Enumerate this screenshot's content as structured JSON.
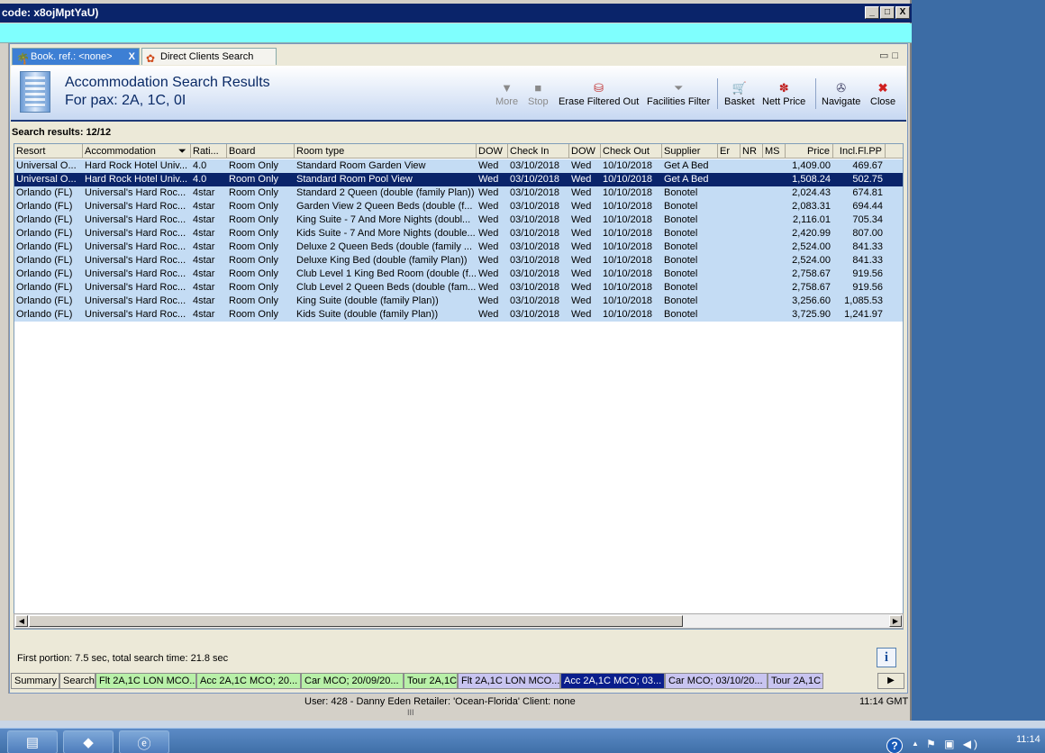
{
  "window": {
    "title": "code: x8ojMptYaU)",
    "minimize": "_",
    "maximize": "□",
    "close": "X"
  },
  "tabs": [
    {
      "label": "Book. ref.: <none>",
      "close": "X"
    },
    {
      "label": "Direct Clients Search"
    }
  ],
  "header": {
    "title": "Accommodation Search Results",
    "subtitle": "For pax: 2A, 1C, 0I"
  },
  "toolbar": {
    "more": "More",
    "stop": "Stop",
    "erase": "Erase Filtered Out",
    "facilities": "Facilities Filter",
    "basket": "Basket",
    "nett": "Nett Price",
    "navigate": "Navigate",
    "close": "Close"
  },
  "results": {
    "label": "Search results: 12/12",
    "columns": [
      "Resort",
      "Accommodation",
      "Rati...",
      "Board",
      "Room type",
      "DOW",
      "Check In",
      "DOW",
      "Check Out",
      "Supplier",
      "Er",
      "NR",
      "MS",
      "Price",
      "Incl.Fl.PP"
    ],
    "rows": [
      [
        "Universal O...",
        "Hard Rock Hotel Univ...",
        "4.0",
        "Room Only",
        "Standard Room Garden View",
        "Wed",
        "03/10/2018",
        "Wed",
        "10/10/2018",
        "Get A Bed",
        "",
        "",
        "",
        "1,409.00",
        "469.67"
      ],
      [
        "Universal O...",
        "Hard Rock Hotel Univ...",
        "4.0",
        "Room Only",
        "Standard Room Pool View",
        "Wed",
        "03/10/2018",
        "Wed",
        "10/10/2018",
        "Get A Bed",
        "",
        "",
        "",
        "1,508.24",
        "502.75"
      ],
      [
        "Orlando (FL)",
        "Universal's Hard Roc...",
        "4star",
        "Room Only",
        "Standard 2 Queen (double (family Plan))",
        "Wed",
        "03/10/2018",
        "Wed",
        "10/10/2018",
        "Bonotel",
        "",
        "",
        "",
        "2,024.43",
        "674.81"
      ],
      [
        "Orlando (FL)",
        "Universal's Hard Roc...",
        "4star",
        "Room Only",
        "Garden View 2 Queen Beds (double (f...",
        "Wed",
        "03/10/2018",
        "Wed",
        "10/10/2018",
        "Bonotel",
        "",
        "",
        "",
        "2,083.31",
        "694.44"
      ],
      [
        "Orlando (FL)",
        "Universal's Hard Roc...",
        "4star",
        "Room Only",
        "King Suite - 7 And More Nights (doubl...",
        "Wed",
        "03/10/2018",
        "Wed",
        "10/10/2018",
        "Bonotel",
        "",
        "",
        "",
        "2,116.01",
        "705.34"
      ],
      [
        "Orlando (FL)",
        "Universal's Hard Roc...",
        "4star",
        "Room Only",
        "Kids Suite - 7 And More Nights (double...",
        "Wed",
        "03/10/2018",
        "Wed",
        "10/10/2018",
        "Bonotel",
        "",
        "",
        "",
        "2,420.99",
        "807.00"
      ],
      [
        "Orlando (FL)",
        "Universal's Hard Roc...",
        "4star",
        "Room Only",
        "Deluxe 2 Queen Beds (double (family ...",
        "Wed",
        "03/10/2018",
        "Wed",
        "10/10/2018",
        "Bonotel",
        "",
        "",
        "",
        "2,524.00",
        "841.33"
      ],
      [
        "Orlando (FL)",
        "Universal's Hard Roc...",
        "4star",
        "Room Only",
        "Deluxe King Bed (double (family Plan))",
        "Wed",
        "03/10/2018",
        "Wed",
        "10/10/2018",
        "Bonotel",
        "",
        "",
        "",
        "2,524.00",
        "841.33"
      ],
      [
        "Orlando (FL)",
        "Universal's Hard Roc...",
        "4star",
        "Room Only",
        "Club Level 1 King Bed Room (double (f...",
        "Wed",
        "03/10/2018",
        "Wed",
        "10/10/2018",
        "Bonotel",
        "",
        "",
        "",
        "2,758.67",
        "919.56"
      ],
      [
        "Orlando (FL)",
        "Universal's Hard Roc...",
        "4star",
        "Room Only",
        "Club Level 2 Queen Beds (double (fam...",
        "Wed",
        "03/10/2018",
        "Wed",
        "10/10/2018",
        "Bonotel",
        "",
        "",
        "",
        "2,758.67",
        "919.56"
      ],
      [
        "Orlando (FL)",
        "Universal's Hard Roc...",
        "4star",
        "Room Only",
        "King Suite (double (family Plan))",
        "Wed",
        "03/10/2018",
        "Wed",
        "10/10/2018",
        "Bonotel",
        "",
        "",
        "",
        "3,256.60",
        "1,085.53"
      ],
      [
        "Orlando (FL)",
        "Universal's Hard Roc...",
        "4star",
        "Room Only",
        "Kids Suite (double (family Plan))",
        "Wed",
        "03/10/2018",
        "Wed",
        "10/10/2018",
        "Bonotel",
        "",
        "",
        "",
        "3,725.90",
        "1,241.97"
      ]
    ]
  },
  "timing": "First portion: 7.5 sec, total search time: 21.8 sec",
  "info": "i",
  "bottom_tabs": [
    {
      "label": "Summary",
      "color": "#ece9d8"
    },
    {
      "label": "Search",
      "color": "#ece9d8"
    },
    {
      "label": "Flt 2A,1C LON MCO...",
      "color": "#b8f0a8"
    },
    {
      "label": "Acc 2A,1C MCO; 20...",
      "color": "#b8f0a8"
    },
    {
      "label": "Car MCO; 20/09/20...",
      "color": "#b8f0a8"
    },
    {
      "label": "Tour 2A,1C",
      "color": "#b8f0a8"
    },
    {
      "label": "Flt 2A,1C LON MCO...",
      "color": "#c8c4f0"
    },
    {
      "label": "Acc 2A,1C MCO; 03...",
      "color": "#0a1e8c"
    },
    {
      "label": "Car MCO; 03/10/20...",
      "color": "#c8c4f0"
    },
    {
      "label": "Tour 2A,1C",
      "color": "#c8c4f0"
    }
  ],
  "arrow": "▶",
  "status": {
    "user": "User: 428 - Danny Eden    Retailer: 'Ocean-Florida'    Client: none",
    "clock": "11:14 GMT"
  },
  "grip": "III",
  "tray": {
    "help": "?",
    "up": "▲",
    "icons": "⚑ ▣ ◀)",
    "time": "11:14"
  },
  "colors": {
    "title_bar": "#0a246a",
    "accent": "#7ffffe",
    "row_alt": "#c4dcf4",
    "selected": "#0a246a"
  }
}
